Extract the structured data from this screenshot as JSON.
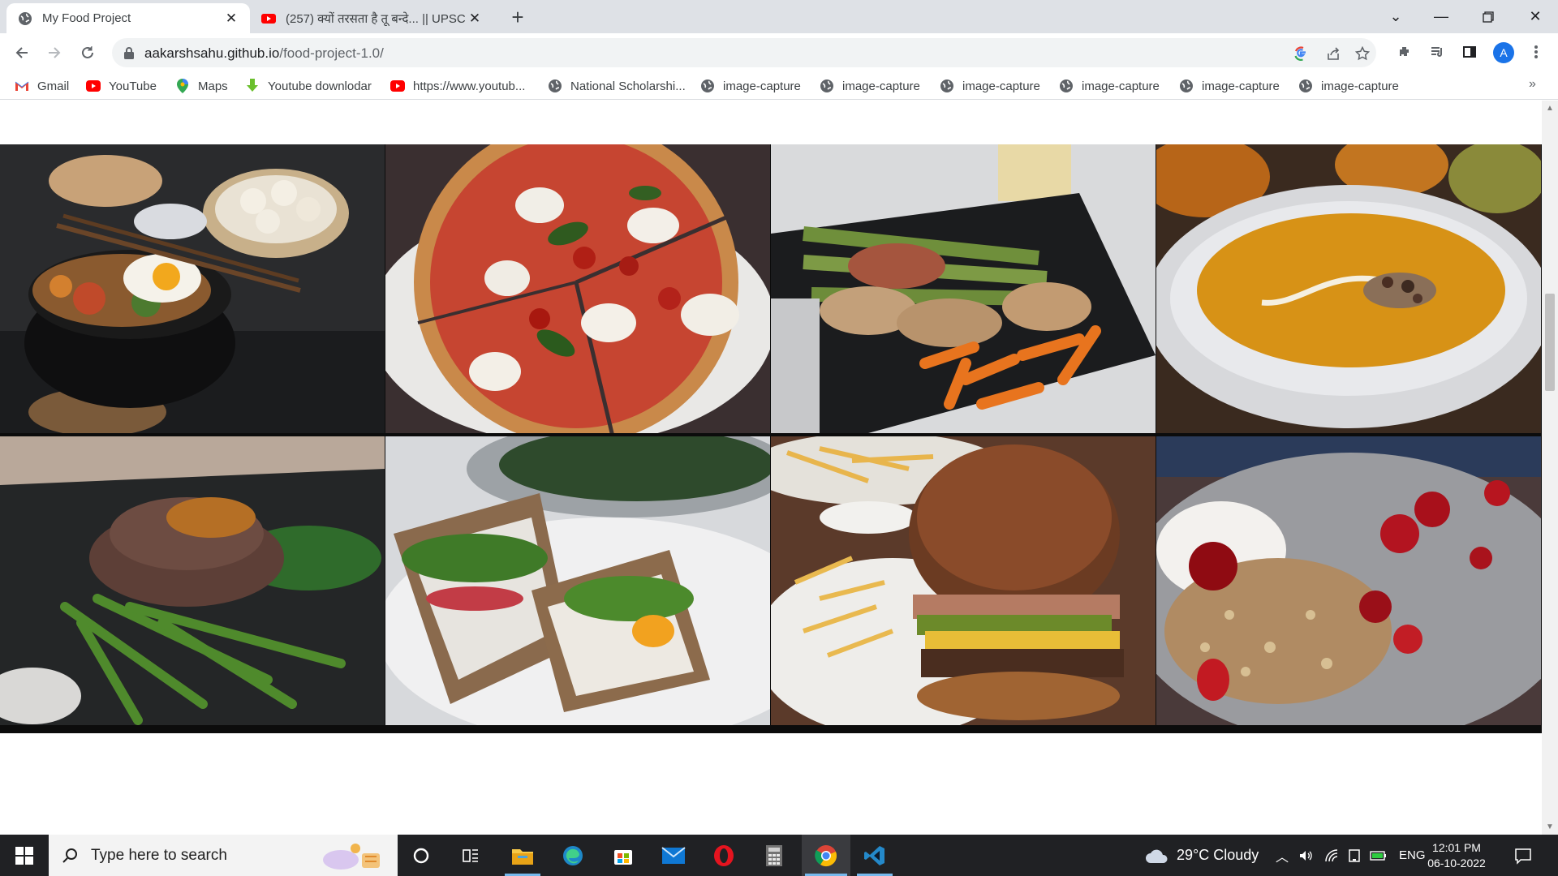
{
  "browser": {
    "tabs": [
      {
        "title": "My Food Project",
        "icon": "globe-icon",
        "active": true
      },
      {
        "title": "(257) क्यों तरसता है तू बन्दे... || UPSC",
        "icon": "youtube-icon",
        "active": false
      }
    ],
    "address": {
      "host": "aakarshsahu.github.io",
      "path": "/food-project-1.0/"
    },
    "profile_initial": "A"
  },
  "bookmarks": [
    {
      "label": "Gmail",
      "icon": "gmail-icon"
    },
    {
      "label": "YouTube",
      "icon": "youtube-icon"
    },
    {
      "label": "Maps",
      "icon": "maps-icon"
    },
    {
      "label": "Youtube downlodar",
      "icon": "download-icon"
    },
    {
      "label": "https://www.youtub...",
      "icon": "youtube-icon"
    },
    {
      "label": "National Scholarshi...",
      "icon": "globe-icon"
    },
    {
      "label": "image-capture",
      "icon": "globe-icon"
    },
    {
      "label": "image-capture",
      "icon": "globe-icon"
    },
    {
      "label": "image-capture",
      "icon": "globe-icon"
    },
    {
      "label": "image-capture",
      "icon": "globe-icon"
    },
    {
      "label": "image-capture",
      "icon": "globe-icon"
    },
    {
      "label": "image-capture",
      "icon": "globe-icon"
    }
  ],
  "gallery": {
    "photos": [
      "bibimbap",
      "pizza",
      "chicken-asparagus",
      "pumpkin-soup",
      "steak-green-beans",
      "sandwich",
      "burger-fries",
      "granola-cherry"
    ]
  },
  "taskbar": {
    "search_placeholder": "Type here to search",
    "weather": "29°C  Cloudy",
    "language": "ENG",
    "time": "12:01 PM",
    "date": "06-10-2022"
  },
  "colors": {
    "chrome_tabstrip": "#dee1e6",
    "taskbar": "#202124",
    "accent": "#1a73e8"
  }
}
